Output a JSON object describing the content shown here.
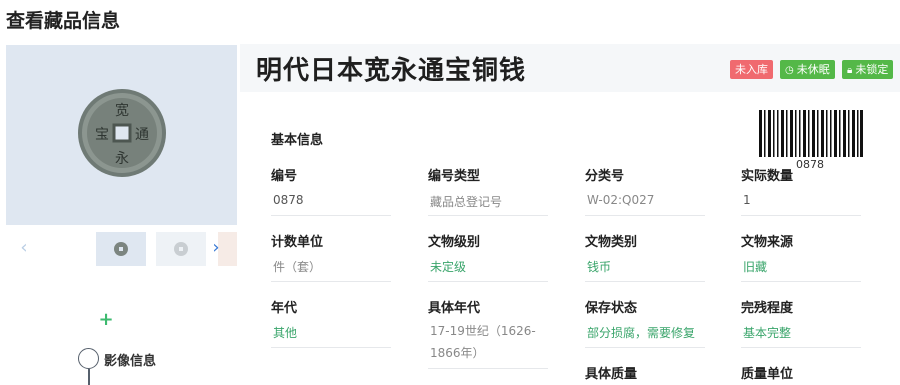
{
  "page": {
    "title": "查看藏品信息"
  },
  "object": {
    "title": "明代日本宽永通宝铜钱",
    "badges": [
      {
        "label": "未入库",
        "color": "#f06a6f",
        "icon": ""
      },
      {
        "label": "未休眠",
        "color": "#54b848",
        "icon": "clock-icon"
      },
      {
        "label": "未锁定",
        "color": "#54b848",
        "icon": "lock-icon"
      }
    ],
    "barcode_number": "0878"
  },
  "sidebar": {
    "add_icon": "plus-icon",
    "timeline": {
      "label": "影像信息"
    }
  },
  "basic_info": {
    "section_title": "基本信息",
    "fields": [
      {
        "label": "编号",
        "value": "0878"
      },
      {
        "label": "编号类型",
        "value": "藏品总登记号"
      },
      {
        "label": "分类号",
        "value": "W-02:Q027"
      },
      {
        "label": "实际数量",
        "value": "1"
      },
      {
        "label": "计数单位",
        "value": "件（套）"
      },
      {
        "label": "文物级别",
        "value": "未定级"
      },
      {
        "label": "文物类别",
        "value": "钱币"
      },
      {
        "label": "文物来源",
        "value": "旧藏"
      },
      {
        "label": "年代",
        "value": "其他"
      },
      {
        "label": "具体年代",
        "value": "17-19世纪（1626-1866年）"
      },
      {
        "label": "保存状态",
        "value": "部分损腐，需要修复"
      },
      {
        "label": "完残程度",
        "value": "基本完整"
      },
      {
        "label": "具体质量",
        "value": ""
      },
      {
        "label": "质量单位",
        "value": ""
      }
    ]
  },
  "colors": {
    "accent_green": "#3aa56b",
    "badge_red": "#f06a6f",
    "badge_green": "#54b848",
    "link_blue": "#3a7ad5"
  }
}
